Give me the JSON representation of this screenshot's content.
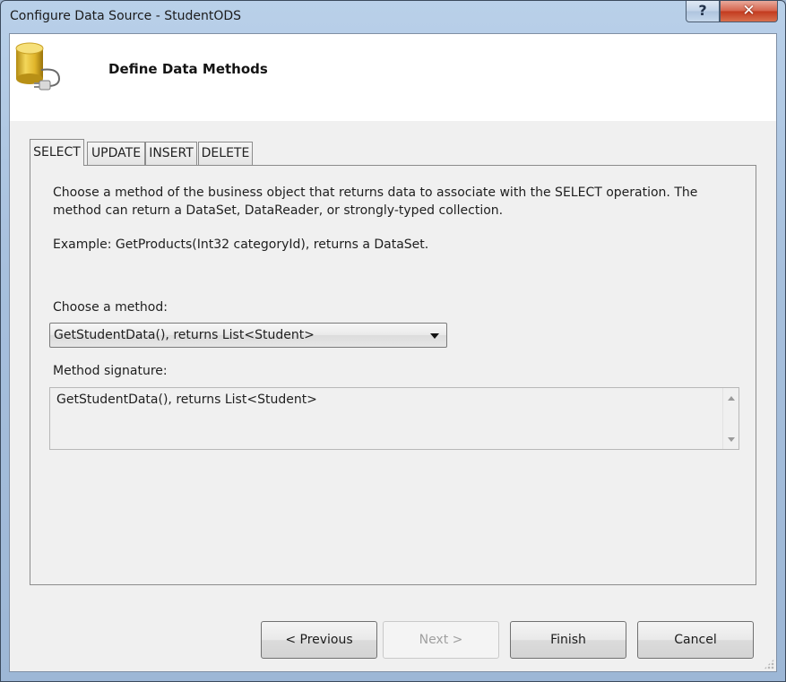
{
  "window": {
    "title": "Configure Data Source - StudentODS",
    "help_glyph": "?",
    "close_glyph": "✕"
  },
  "header": {
    "title": "Define Data Methods",
    "icon": "database-plug-icon"
  },
  "tabs": [
    {
      "label": "SELECT",
      "active": true
    },
    {
      "label": "UPDATE",
      "active": false
    },
    {
      "label": "INSERT",
      "active": false
    },
    {
      "label": "DELETE",
      "active": false
    }
  ],
  "panel": {
    "description": "Choose a method of the business object that returns data to associate with the SELECT operation. The method can return a DataSet, DataReader, or strongly-typed collection.",
    "example": "Example: GetProducts(Int32 categoryId), returns a DataSet.",
    "choose_label": "Choose a method:",
    "selected_method": "GetStudentData(), returns List<Student>",
    "signature_label": "Method signature:",
    "signature_value": "GetStudentData(), returns List<Student>"
  },
  "buttons": {
    "previous": "< Previous",
    "next": "Next >",
    "finish": "Finish",
    "cancel": "Cancel"
  },
  "colors": {
    "close_accent": "#c2391e",
    "frame": "#a7c0dd"
  }
}
